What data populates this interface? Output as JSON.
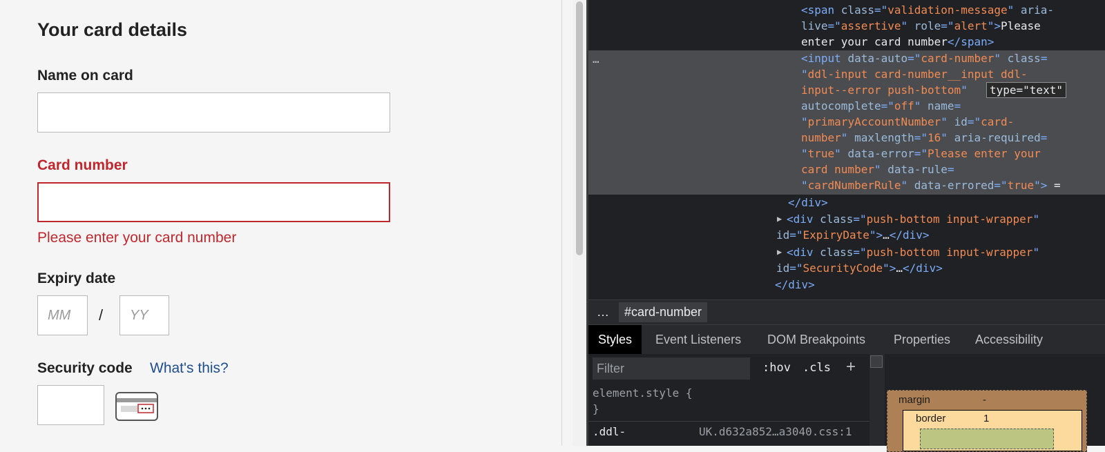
{
  "form": {
    "heading": "Your card details",
    "name_label": "Name on card",
    "name_value": "",
    "card_label": "Card number",
    "card_value": "",
    "card_error": "Please enter your card number",
    "expiry_label": "Expiry date",
    "expiry_mm_placeholder": "MM",
    "expiry_separator": "/",
    "expiry_yy_placeholder": "YY",
    "security_label": "Security code",
    "security_help_link": "What's this?",
    "security_value": "",
    "card_icon": "card-security-code-icon",
    "error_color": "#c0272d",
    "link_color": "#1f4e8c"
  },
  "devtools": {
    "html_lines": [
      [
        {
          "c": "tag",
          "t": "<span "
        },
        {
          "c": "an",
          "t": "class"
        },
        {
          "c": "tag",
          "t": "=\""
        },
        {
          "c": "av",
          "t": "validation-message"
        },
        {
          "c": "tag",
          "t": "\" "
        },
        {
          "c": "an",
          "t": "aria-"
        }
      ],
      [
        {
          "c": "an",
          "t": "live"
        },
        {
          "c": "tag",
          "t": "=\""
        },
        {
          "c": "av",
          "t": "assertive"
        },
        {
          "c": "tag",
          "t": "\" "
        },
        {
          "c": "an",
          "t": "role"
        },
        {
          "c": "tag",
          "t": "=\""
        },
        {
          "c": "av",
          "t": "alert"
        },
        {
          "c": "tag",
          "t": "\">"
        },
        {
          "c": "tx",
          "t": "Please"
        }
      ],
      [
        {
          "c": "tx",
          "t": "enter your card number"
        },
        {
          "c": "tag",
          "t": "</span>"
        }
      ],
      [
        {
          "c": "tag",
          "t": "<input "
        },
        {
          "c": "an",
          "t": "data-auto"
        },
        {
          "c": "tag",
          "t": "=\""
        },
        {
          "c": "av",
          "t": "card-number"
        },
        {
          "c": "tag",
          "t": "\" "
        },
        {
          "c": "an",
          "t": "class"
        },
        {
          "c": "tag",
          "t": "="
        }
      ],
      [
        {
          "c": "tag",
          "t": "\""
        },
        {
          "c": "av",
          "t": "ddl-input card-number__input ddl-"
        }
      ],
      [
        {
          "c": "av",
          "t": "input--error push-bottom"
        },
        {
          "c": "tag",
          "t": "\""
        }
      ],
      [
        {
          "c": "an",
          "t": "autocomplete"
        },
        {
          "c": "tag",
          "t": "=\""
        },
        {
          "c": "av",
          "t": "off"
        },
        {
          "c": "tag",
          "t": "\" "
        },
        {
          "c": "an",
          "t": "name"
        },
        {
          "c": "tag",
          "t": "="
        }
      ],
      [
        {
          "c": "tag",
          "t": "\""
        },
        {
          "c": "av",
          "t": "primaryAccountNumber"
        },
        {
          "c": "tag",
          "t": "\" "
        },
        {
          "c": "an",
          "t": "id"
        },
        {
          "c": "tag",
          "t": "=\""
        },
        {
          "c": "av",
          "t": "card-"
        }
      ],
      [
        {
          "c": "av",
          "t": "number"
        },
        {
          "c": "tag",
          "t": "\" "
        },
        {
          "c": "an",
          "t": "maxlength"
        },
        {
          "c": "tag",
          "t": "=\""
        },
        {
          "c": "av",
          "t": "16"
        },
        {
          "c": "tag",
          "t": "\" "
        },
        {
          "c": "an",
          "t": "aria-required"
        },
        {
          "c": "tag",
          "t": "="
        }
      ],
      [
        {
          "c": "tag",
          "t": "\""
        },
        {
          "c": "av",
          "t": "true"
        },
        {
          "c": "tag",
          "t": "\" "
        },
        {
          "c": "an",
          "t": "data-error"
        },
        {
          "c": "tag",
          "t": "=\""
        },
        {
          "c": "av",
          "t": "Please enter your"
        }
      ],
      [
        {
          "c": "av",
          "t": "card number"
        },
        {
          "c": "tag",
          "t": "\" "
        },
        {
          "c": "an",
          "t": "data-rule"
        },
        {
          "c": "tag",
          "t": "="
        }
      ],
      [
        {
          "c": "tag",
          "t": "\""
        },
        {
          "c": "av",
          "t": "cardNumberRule"
        },
        {
          "c": "tag",
          "t": "\" "
        },
        {
          "c": "an",
          "t": "data-errored"
        },
        {
          "c": "tag",
          "t": "=\""
        },
        {
          "c": "av",
          "t": "true"
        },
        {
          "c": "tag",
          "t": "\">"
        },
        {
          "c": "tx",
          "t": " ="
        }
      ],
      [
        {
          "c": "tag",
          "t": "</div>"
        }
      ],
      [
        {
          "c": "tag",
          "t": "<div "
        },
        {
          "c": "an",
          "t": "class"
        },
        {
          "c": "tag",
          "t": "=\""
        },
        {
          "c": "av",
          "t": "push-bottom input-wrapper"
        },
        {
          "c": "tag",
          "t": "\""
        }
      ],
      [
        {
          "c": "an",
          "t": "id"
        },
        {
          "c": "tag",
          "t": "=\""
        },
        {
          "c": "av",
          "t": "ExpiryDate"
        },
        {
          "c": "tag",
          "t": "\">"
        },
        {
          "c": "tx",
          "t": "…"
        },
        {
          "c": "tag",
          "t": "</div>"
        }
      ],
      [
        {
          "c": "tag",
          "t": "<div "
        },
        {
          "c": "an",
          "t": "class"
        },
        {
          "c": "tag",
          "t": "=\""
        },
        {
          "c": "av",
          "t": "push-bottom input-wrapper"
        },
        {
          "c": "tag",
          "t": "\""
        }
      ],
      [
        {
          "c": "an",
          "t": "id"
        },
        {
          "c": "tag",
          "t": "=\""
        },
        {
          "c": "av",
          "t": "SecurityCode"
        },
        {
          "c": "tag",
          "t": "\">"
        },
        {
          "c": "tx",
          "t": "…"
        },
        {
          "c": "tag",
          "t": "</div>"
        }
      ],
      [
        {
          "c": "tag",
          "t": "</div>"
        }
      ]
    ],
    "type_tooltip": "type=\"text\"",
    "ellipsis": "…",
    "breadcrumb_more": "…",
    "breadcrumb": "#card-number",
    "tabs": [
      "Styles",
      "Event Listeners",
      "DOM Breakpoints",
      "Properties",
      "Accessibility"
    ],
    "active_tab": "Styles",
    "filter_placeholder": "Filter",
    "hov": ":hov",
    "cls": ".cls",
    "add": "+",
    "element_style_open": "element.style {",
    "element_style_close": "}",
    "rule_selector": ".ddl-",
    "rule_source": "UK.d632a852…a3040.css:1",
    "box_margin_label": "margin",
    "box_margin_value": "-",
    "box_border_label": "border",
    "box_border_value": "1"
  }
}
